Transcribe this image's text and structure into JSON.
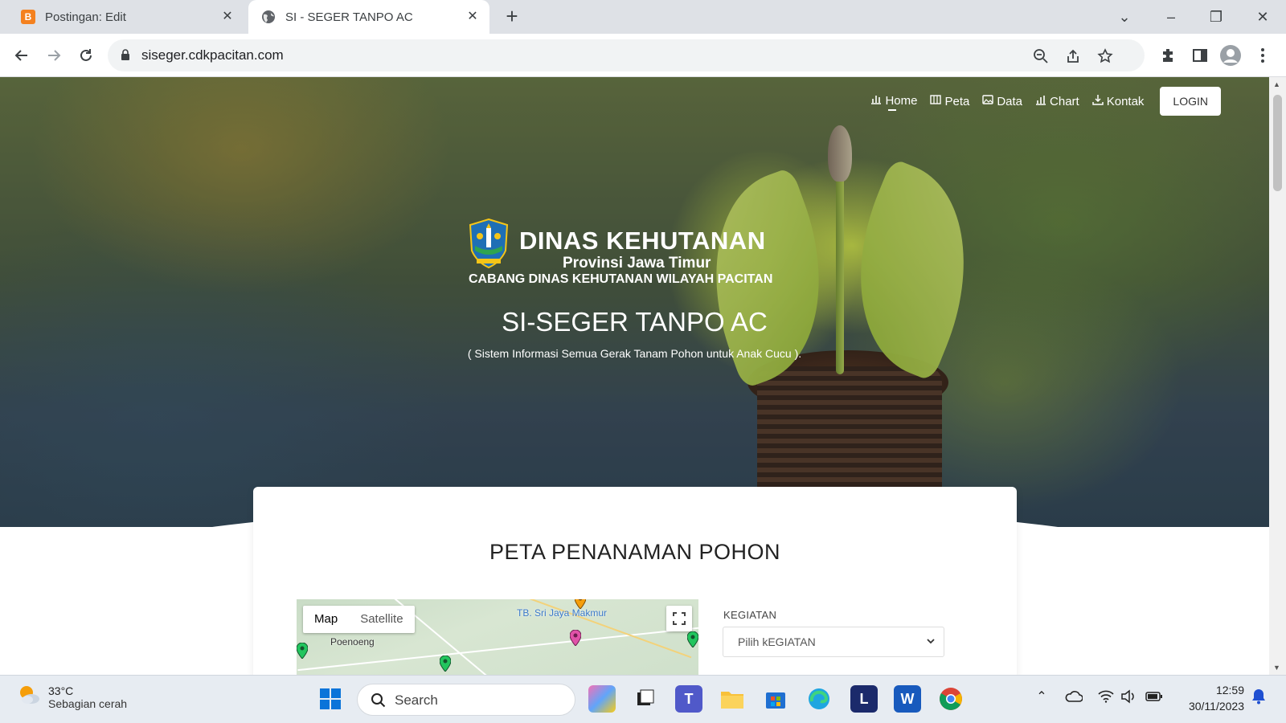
{
  "browser": {
    "tabs": [
      {
        "title": "Postingan: Edit",
        "icon": "blogger-icon"
      },
      {
        "title": "SI - SEGER TANPO AC",
        "icon": "globe-icon"
      }
    ],
    "url": "siseger.cdkpacitan.com"
  },
  "nav": {
    "items": [
      {
        "label": "Home",
        "icon": "bar-chart-icon"
      },
      {
        "label": "Peta",
        "icon": "map-icon"
      },
      {
        "label": "Data",
        "icon": "image-icon"
      },
      {
        "label": "Chart",
        "icon": "bar-chart-icon"
      },
      {
        "label": "Kontak",
        "icon": "download-icon"
      }
    ],
    "login": "LOGIN"
  },
  "hero": {
    "org_title": "DINAS KEHUTANAN",
    "org_province": "Provinsi Jawa Timur",
    "org_branch": "CABANG DINAS KEHUTANAN WILAYAH PACITAN",
    "app_title": "SI-SEGER TANPO AC",
    "app_subtitle": "( Sistem Informasi Semua Gerak Tanam Pohon untuk Anak Cucu )."
  },
  "section": {
    "title": "PETA PENANAMAN POHON",
    "map": {
      "type_map": "Map",
      "type_satellite": "Satellite",
      "labels": [
        "Poenoeng",
        "TB. Sri Jaya Makmur"
      ]
    },
    "filter_label": "KEGIATAN",
    "filter_value": "Pilih kEGIATAN"
  },
  "taskbar": {
    "temperature": "33°C",
    "weather": "Sebagian cerah",
    "search": "Search",
    "time": "12:59",
    "date": "30/11/2023"
  }
}
